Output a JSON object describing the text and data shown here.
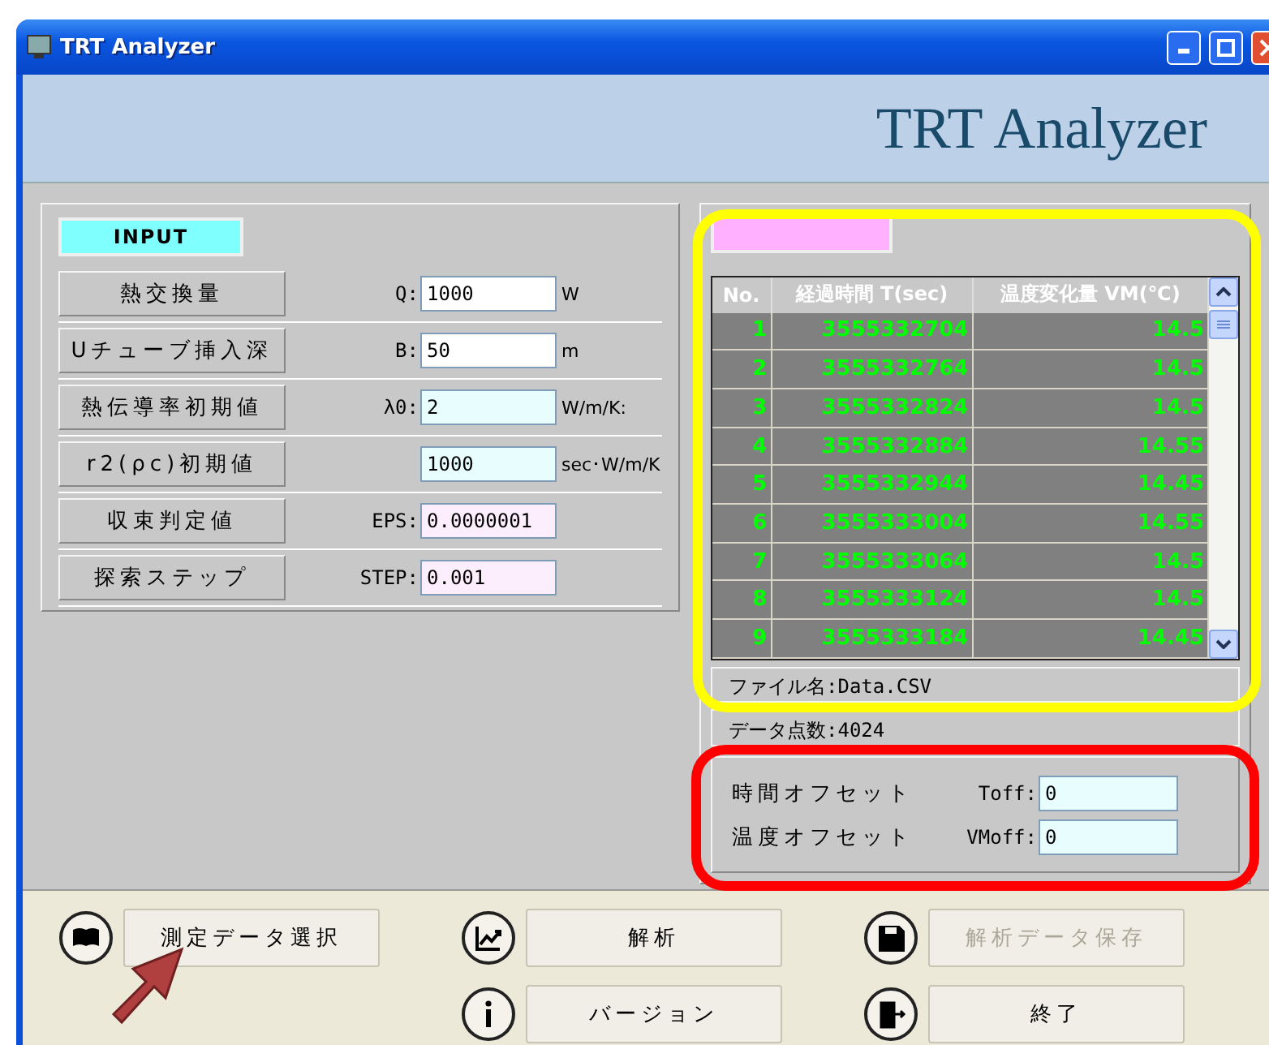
{
  "window": {
    "title": "TRT Analyzer"
  },
  "header": {
    "title": "TRT Analyzer"
  },
  "input_panel": {
    "label": "INPUT",
    "rows": [
      {
        "label": "熱交換量",
        "field_label": "Q:",
        "value": "1000",
        "unit": "W",
        "color": "#ffffff"
      },
      {
        "label": "Uチューブ挿入深",
        "field_label": "B:",
        "value": "50",
        "unit": "m",
        "color": "#ffffff"
      },
      {
        "label": "熱伝導率初期値",
        "field_label": "λ0:",
        "value": "2",
        "unit": "W/m/K:",
        "color": "#e8fefe"
      },
      {
        "label": "r2(ρc)初期値",
        "value": "1000",
        "unit": "sec･W/m/K",
        "color": "#e8fefe"
      },
      {
        "label": "収束判定値",
        "field_label": "EPS:",
        "value": "0.0000001",
        "color": "#fdeefd"
      },
      {
        "label": "探索ステップ",
        "field_label": "STEP:",
        "value": "0.001",
        "color": "#fdeefd"
      }
    ]
  },
  "data_panel": {
    "table": {
      "columns": [
        "No.",
        "経過時間 T(sec)",
        "温度変化量 VM(℃)"
      ],
      "rows": [
        [
          "1",
          "3555332704",
          "14.5"
        ],
        [
          "2",
          "3555332764",
          "14.5"
        ],
        [
          "3",
          "3555332824",
          "14.5"
        ],
        [
          "4",
          "3555332884",
          "14.55"
        ],
        [
          "5",
          "3555332944",
          "14.45"
        ],
        [
          "6",
          "3555333004",
          "14.55"
        ],
        [
          "7",
          "3555333064",
          "14.5"
        ],
        [
          "8",
          "3555333124",
          "14.5"
        ],
        [
          "9",
          "3555333184",
          "14.45"
        ]
      ]
    },
    "file_info": [
      "ファイル名:Data.CSV",
      "データ点数:4024"
    ],
    "offsets": [
      {
        "label": "時間オフセット",
        "field_label": "Toff:",
        "value": "0"
      },
      {
        "label": "温度オフセット",
        "field_label": "VMoff:",
        "value": "0"
      }
    ]
  },
  "button_rows": [
    [
      {
        "kind": "book",
        "label": "測定データ選択",
        "disabled": false
      },
      {
        "kind": "chart",
        "label": "解析",
        "disabled": false
      },
      {
        "kind": "disk",
        "label": "解析データ保存",
        "disabled": true
      }
    ],
    [
      {
        "kind": "info",
        "label": "バージョン",
        "disabled": false
      },
      {
        "kind": "exit",
        "label": "終了",
        "disabled": false
      }
    ]
  ],
  "annotations": [
    {
      "kind": "ring",
      "color": "#ffff00"
    },
    {
      "kind": "ring",
      "color": "#ff0000"
    },
    {
      "kind": "arrow"
    }
  ]
}
